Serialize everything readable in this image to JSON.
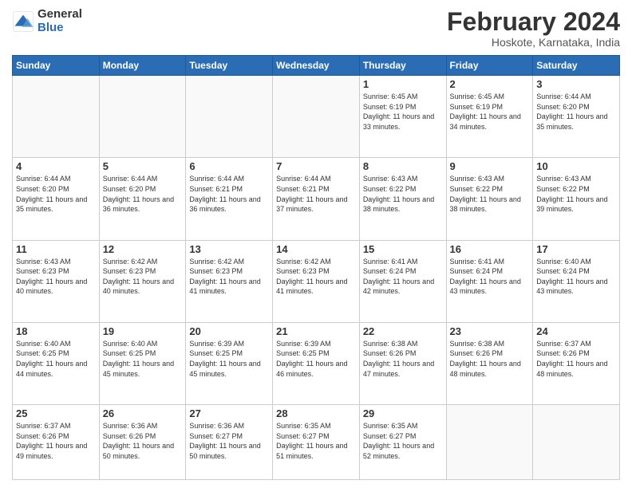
{
  "logo": {
    "general": "General",
    "blue": "Blue"
  },
  "title": "February 2024",
  "subtitle": "Hoskote, Karnataka, India",
  "days_of_week": [
    "Sunday",
    "Monday",
    "Tuesday",
    "Wednesday",
    "Thursday",
    "Friday",
    "Saturday"
  ],
  "weeks": [
    [
      {
        "day": "",
        "info": ""
      },
      {
        "day": "",
        "info": ""
      },
      {
        "day": "",
        "info": ""
      },
      {
        "day": "",
        "info": ""
      },
      {
        "day": "1",
        "info": "Sunrise: 6:45 AM\nSunset: 6:19 PM\nDaylight: 11 hours and 33 minutes."
      },
      {
        "day": "2",
        "info": "Sunrise: 6:45 AM\nSunset: 6:19 PM\nDaylight: 11 hours and 34 minutes."
      },
      {
        "day": "3",
        "info": "Sunrise: 6:44 AM\nSunset: 6:20 PM\nDaylight: 11 hours and 35 minutes."
      }
    ],
    [
      {
        "day": "4",
        "info": "Sunrise: 6:44 AM\nSunset: 6:20 PM\nDaylight: 11 hours and 35 minutes."
      },
      {
        "day": "5",
        "info": "Sunrise: 6:44 AM\nSunset: 6:20 PM\nDaylight: 11 hours and 36 minutes."
      },
      {
        "day": "6",
        "info": "Sunrise: 6:44 AM\nSunset: 6:21 PM\nDaylight: 11 hours and 36 minutes."
      },
      {
        "day": "7",
        "info": "Sunrise: 6:44 AM\nSunset: 6:21 PM\nDaylight: 11 hours and 37 minutes."
      },
      {
        "day": "8",
        "info": "Sunrise: 6:43 AM\nSunset: 6:22 PM\nDaylight: 11 hours and 38 minutes."
      },
      {
        "day": "9",
        "info": "Sunrise: 6:43 AM\nSunset: 6:22 PM\nDaylight: 11 hours and 38 minutes."
      },
      {
        "day": "10",
        "info": "Sunrise: 6:43 AM\nSunset: 6:22 PM\nDaylight: 11 hours and 39 minutes."
      }
    ],
    [
      {
        "day": "11",
        "info": "Sunrise: 6:43 AM\nSunset: 6:23 PM\nDaylight: 11 hours and 40 minutes."
      },
      {
        "day": "12",
        "info": "Sunrise: 6:42 AM\nSunset: 6:23 PM\nDaylight: 11 hours and 40 minutes."
      },
      {
        "day": "13",
        "info": "Sunrise: 6:42 AM\nSunset: 6:23 PM\nDaylight: 11 hours and 41 minutes."
      },
      {
        "day": "14",
        "info": "Sunrise: 6:42 AM\nSunset: 6:23 PM\nDaylight: 11 hours and 41 minutes."
      },
      {
        "day": "15",
        "info": "Sunrise: 6:41 AM\nSunset: 6:24 PM\nDaylight: 11 hours and 42 minutes."
      },
      {
        "day": "16",
        "info": "Sunrise: 6:41 AM\nSunset: 6:24 PM\nDaylight: 11 hours and 43 minutes."
      },
      {
        "day": "17",
        "info": "Sunrise: 6:40 AM\nSunset: 6:24 PM\nDaylight: 11 hours and 43 minutes."
      }
    ],
    [
      {
        "day": "18",
        "info": "Sunrise: 6:40 AM\nSunset: 6:25 PM\nDaylight: 11 hours and 44 minutes."
      },
      {
        "day": "19",
        "info": "Sunrise: 6:40 AM\nSunset: 6:25 PM\nDaylight: 11 hours and 45 minutes."
      },
      {
        "day": "20",
        "info": "Sunrise: 6:39 AM\nSunset: 6:25 PM\nDaylight: 11 hours and 45 minutes."
      },
      {
        "day": "21",
        "info": "Sunrise: 6:39 AM\nSunset: 6:25 PM\nDaylight: 11 hours and 46 minutes."
      },
      {
        "day": "22",
        "info": "Sunrise: 6:38 AM\nSunset: 6:26 PM\nDaylight: 11 hours and 47 minutes."
      },
      {
        "day": "23",
        "info": "Sunrise: 6:38 AM\nSunset: 6:26 PM\nDaylight: 11 hours and 48 minutes."
      },
      {
        "day": "24",
        "info": "Sunrise: 6:37 AM\nSunset: 6:26 PM\nDaylight: 11 hours and 48 minutes."
      }
    ],
    [
      {
        "day": "25",
        "info": "Sunrise: 6:37 AM\nSunset: 6:26 PM\nDaylight: 11 hours and 49 minutes."
      },
      {
        "day": "26",
        "info": "Sunrise: 6:36 AM\nSunset: 6:26 PM\nDaylight: 11 hours and 50 minutes."
      },
      {
        "day": "27",
        "info": "Sunrise: 6:36 AM\nSunset: 6:27 PM\nDaylight: 11 hours and 50 minutes."
      },
      {
        "day": "28",
        "info": "Sunrise: 6:35 AM\nSunset: 6:27 PM\nDaylight: 11 hours and 51 minutes."
      },
      {
        "day": "29",
        "info": "Sunrise: 6:35 AM\nSunset: 6:27 PM\nDaylight: 11 hours and 52 minutes."
      },
      {
        "day": "",
        "info": ""
      },
      {
        "day": "",
        "info": ""
      }
    ]
  ]
}
